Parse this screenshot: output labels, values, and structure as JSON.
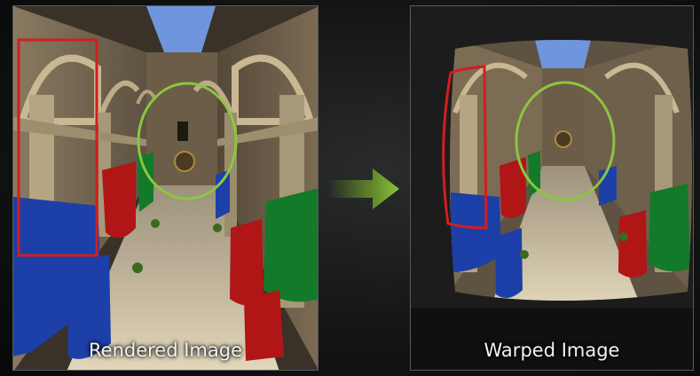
{
  "left_panel": {
    "caption": "Rendered Image"
  },
  "right_panel": {
    "caption": "Warped Image"
  },
  "colors": {
    "highlight_red": "#d21e1e",
    "highlight_green": "#8cc63f",
    "arrow_green": "#6f9a2a",
    "sky": "#6f96dc",
    "floor": "#d8cdb0",
    "stone": "#8a7a60",
    "banner_red": "#b01616",
    "banner_blue": "#1c3fa8",
    "banner_green": "#137a2a"
  }
}
